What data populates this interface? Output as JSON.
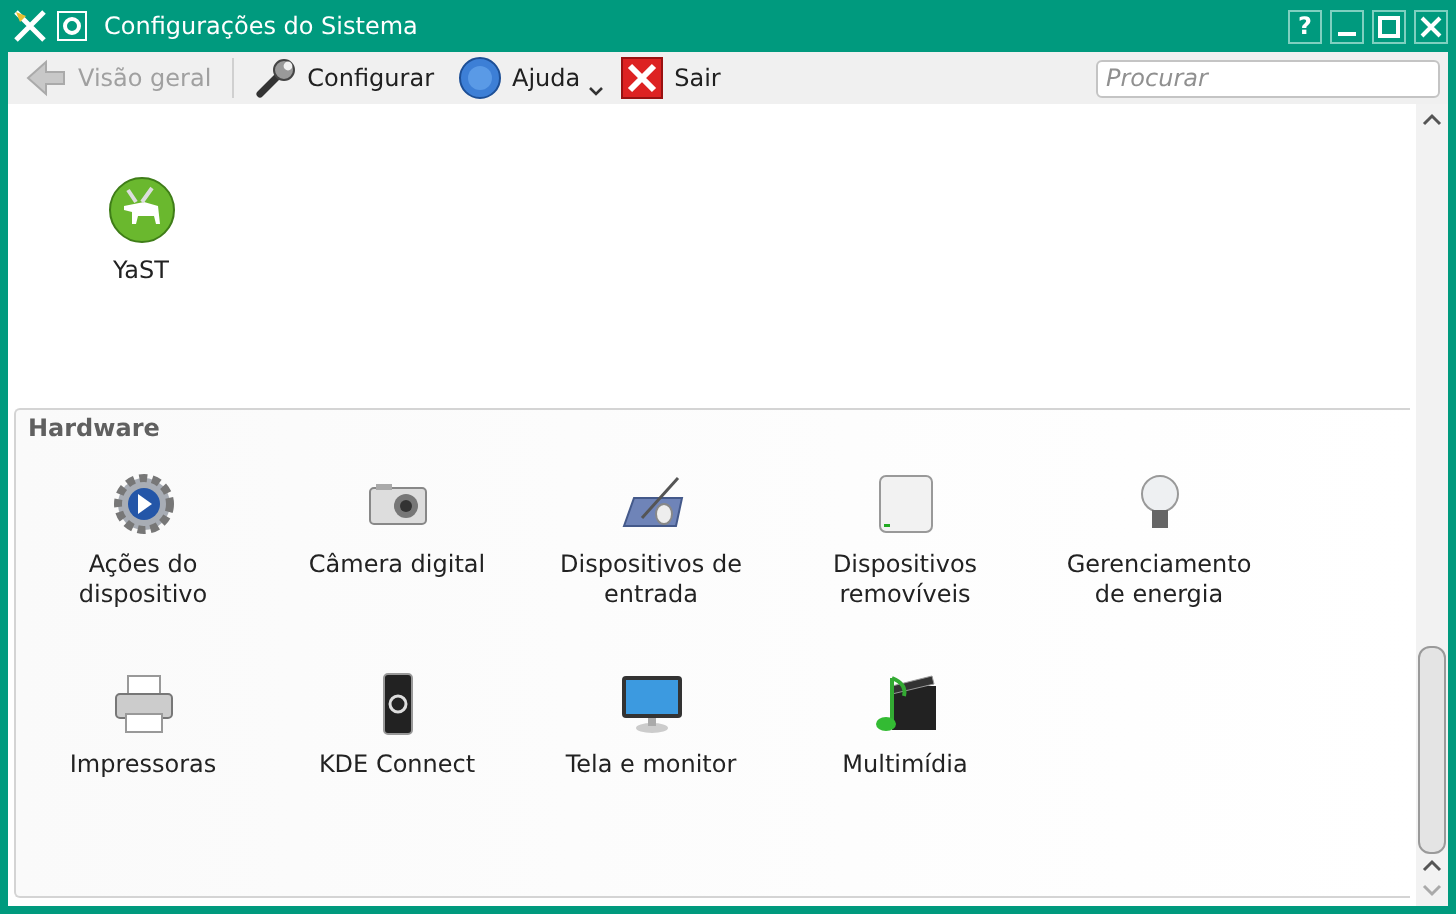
{
  "window": {
    "title": "Configurações do Sistema",
    "help_button": "?"
  },
  "toolbar": [
    {
      "label": "Visão geral",
      "disabled": true
    },
    {
      "label": "Configurar",
      "disabled": false
    },
    {
      "label": "Ajuda",
      "disabled": false,
      "menu": true
    },
    {
      "label": "Sair",
      "disabled": false
    }
  ],
  "search": {
    "placeholder": "Procurar"
  },
  "top_items": [
    {
      "label": "YaST"
    }
  ],
  "sections": [
    {
      "title": "Hardware",
      "items": [
        {
          "label": "Ações do dispositivo"
        },
        {
          "label": "Câmera digital"
        },
        {
          "label": "Dispositivos de entrada"
        },
        {
          "label": "Dispositivos removíveis"
        },
        {
          "label": "Gerenciamento de energia"
        },
        {
          "label": "Impressoras"
        },
        {
          "label": "KDE Connect"
        },
        {
          "label": "Tela e monitor"
        },
        {
          "label": "Multimídia"
        }
      ]
    }
  ]
}
